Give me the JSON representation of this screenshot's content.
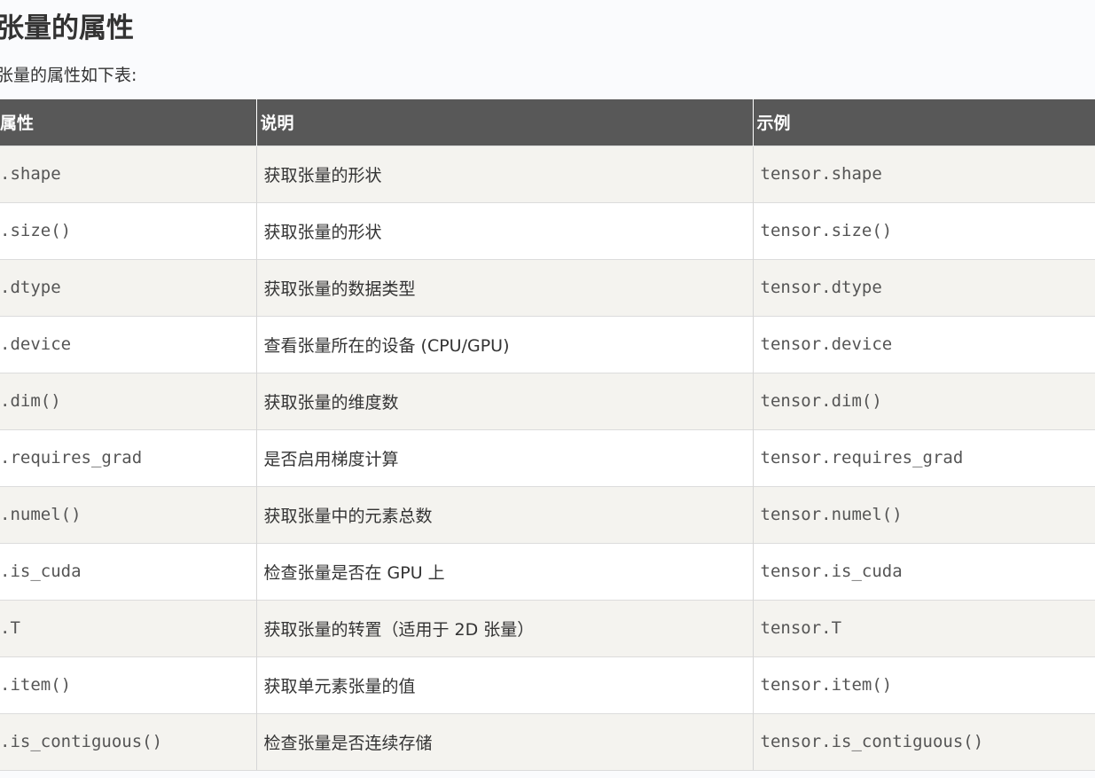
{
  "article": {
    "heading": "张量的属性",
    "intro": "张量的属性如下表:"
  },
  "table": {
    "headers": [
      "属性",
      "说明",
      "示例"
    ],
    "rows": [
      {
        "attr": ".shape",
        "desc": "获取张量的形状",
        "example": "tensor.shape"
      },
      {
        "attr": ".size()",
        "desc": "获取张量的形状",
        "example": "tensor.size()"
      },
      {
        "attr": ".dtype",
        "desc": "获取张量的数据类型",
        "example": "tensor.dtype"
      },
      {
        "attr": ".device",
        "desc": "查看张量所在的设备 (CPU/GPU)",
        "example": "tensor.device"
      },
      {
        "attr": ".dim()",
        "desc": "获取张量的维度数",
        "example": "tensor.dim()"
      },
      {
        "attr": ".requires_grad",
        "desc": "是否启用梯度计算",
        "example": "tensor.requires_grad"
      },
      {
        "attr": ".numel()",
        "desc": "获取张量中的元素总数",
        "example": "tensor.numel()"
      },
      {
        "attr": ".is_cuda",
        "desc": "检查张量是否在 GPU 上",
        "example": "tensor.is_cuda"
      },
      {
        "attr": ".T",
        "desc": "获取张量的转置（适用于 2D 张量）",
        "example": "tensor.T"
      },
      {
        "attr": ".item()",
        "desc": "获取单元素张量的值",
        "example": "tensor.item()"
      },
      {
        "attr": ".is_contiguous()",
        "desc": "检查张量是否连续存储",
        "example": "tensor.is_contiguous()"
      }
    ]
  }
}
